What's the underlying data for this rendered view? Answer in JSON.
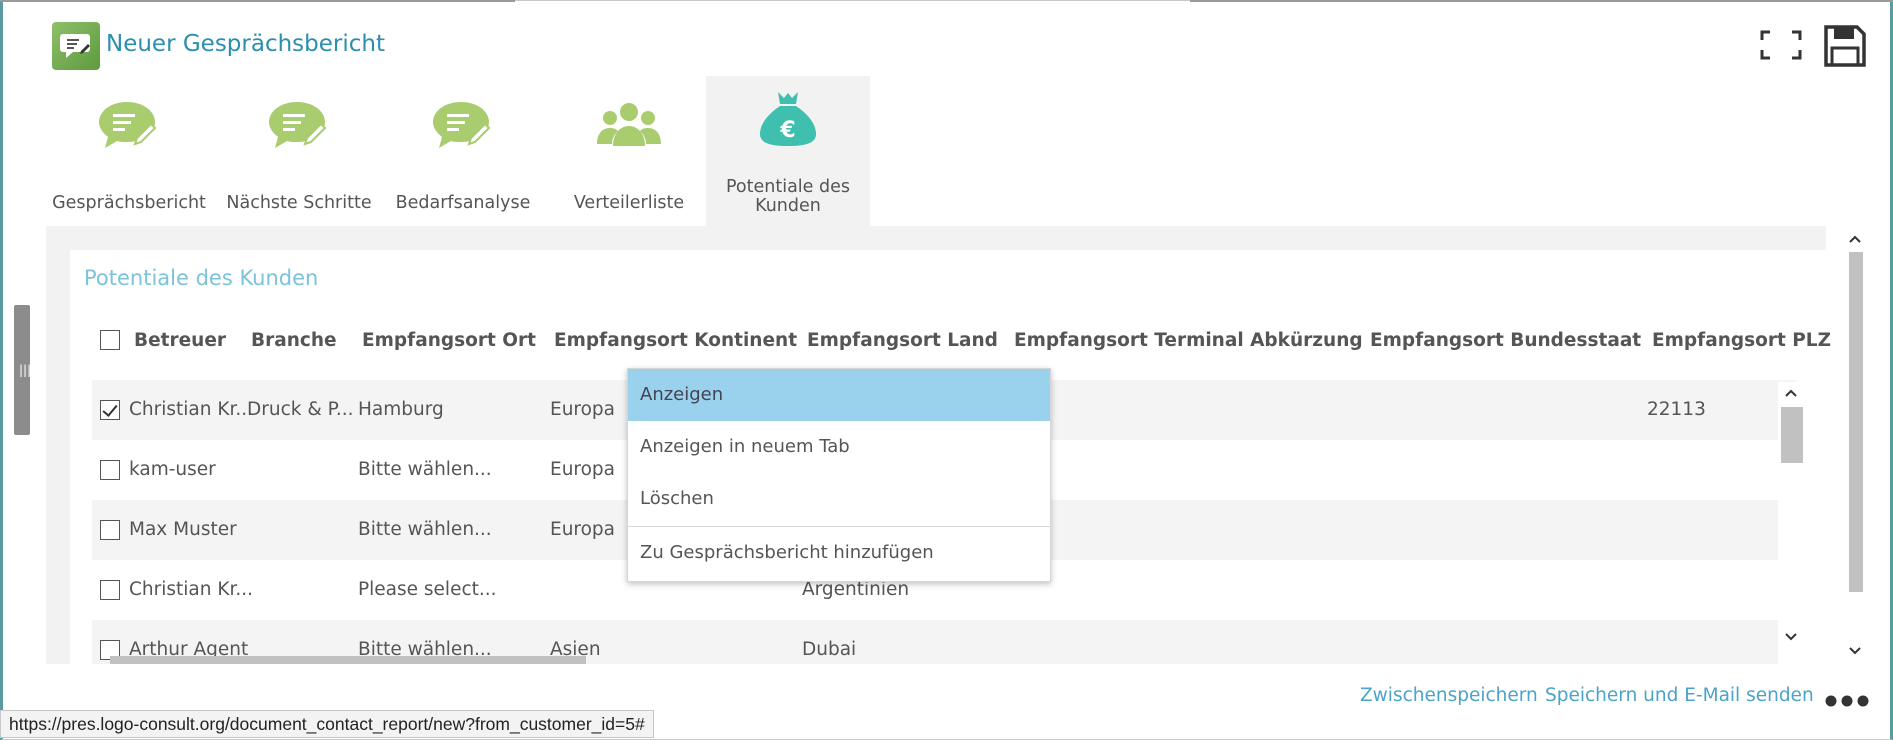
{
  "window": {
    "title": "Neuer Gesprächsbericht"
  },
  "toolbar": {
    "fullscreen_icon": "fullscreen-icon",
    "save_icon": "floppy-disk-icon"
  },
  "tabs": [
    {
      "label": "Gesprächsbericht",
      "icon": "speech-bubble-pencil-icon",
      "active": false
    },
    {
      "label": "Nächste Schritte",
      "icon": "speech-bubble-pencil-icon",
      "active": false
    },
    {
      "label": "Bedarfsanalyse",
      "icon": "speech-bubble-pencil-icon",
      "active": false
    },
    {
      "label": "Verteilerliste",
      "icon": "group-people-icon",
      "active": false
    },
    {
      "label": "Potentiale des Kunden",
      "icon": "money-bag-euro-icon",
      "active": true
    }
  ],
  "panel": {
    "title": "Potentiale des Kunden",
    "columns": [
      "Betreuer",
      "Branche",
      "Empfangsort Ort",
      "Empfangsort Kontinent",
      "Empfangsort Land",
      "Empfangsort Terminal Abkürzung",
      "Empfangsort Bundesstaat",
      "Empfangsort PLZ"
    ],
    "rows": [
      {
        "checked": true,
        "betreuer": "Christian Kr...",
        "branche": "Druck & P...",
        "ort": "Hamburg",
        "kontinent": "Europa",
        "land": "",
        "plz": "22113"
      },
      {
        "checked": false,
        "betreuer": "kam-user",
        "branche": "",
        "ort": "Bitte wählen...",
        "kontinent": "Europa",
        "land": "",
        "plz": ""
      },
      {
        "checked": false,
        "betreuer": "Max Muster",
        "branche": "",
        "ort": "Bitte wählen...",
        "kontinent": "Europa",
        "land": "",
        "plz": ""
      },
      {
        "checked": false,
        "betreuer": "Christian Kr...",
        "branche": "",
        "ort": "Please select...",
        "kontinent": "",
        "land": "Argentinien",
        "plz": ""
      },
      {
        "checked": false,
        "betreuer": "Arthur Agent",
        "branche": "",
        "ort": "Bitte wählen...",
        "kontinent": "Asien",
        "land": "Dubai",
        "plz": ""
      }
    ]
  },
  "context_menu": {
    "items": [
      "Anzeigen",
      "Anzeigen in neuem Tab",
      "Löschen",
      "Zu Gesprächsbericht hinzufügen"
    ]
  },
  "footer": {
    "save_draft": "Zwischenspeichern",
    "save_email": "Speichern und E-Mail senden"
  },
  "status_bar": {
    "url": "https://pres.logo-consult.org/document_contact_report/new?from_customer_id=5#"
  },
  "colors": {
    "accent": "#2b8fae",
    "tab_icon_green": "#a9cc6f",
    "active_icon_teal": "#3fbfae",
    "menu_highlight": "#9ad1ec"
  }
}
